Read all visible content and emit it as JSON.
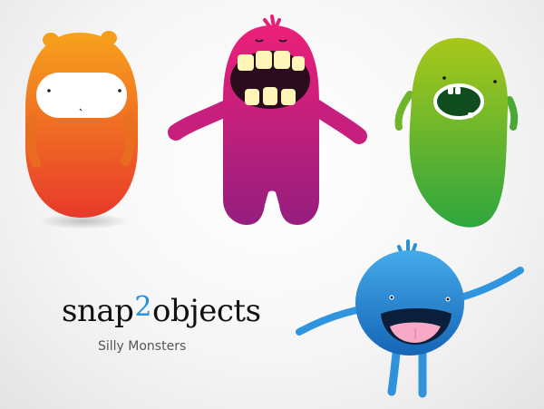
{
  "brand": {
    "name_part1": "snap",
    "name_part2": "2",
    "name_part3": "objects",
    "tagline": "Silly Monsters"
  },
  "colors": {
    "orange_top": "#f7a21b",
    "orange_bottom": "#e8392b",
    "magenta_top": "#e91e7a",
    "magenta_bottom": "#9b1f7c",
    "green_top": "#a7c61a",
    "green_bottom": "#2fa83d",
    "blue_top": "#3fa6e8",
    "blue_bottom": "#1666b8",
    "brand_accent": "#1f8fe0"
  },
  "icons": {
    "orange": "orange-monster-icon",
    "magenta": "magenta-monster-icon",
    "green": "green-monster-icon",
    "blue": "blue-monster-icon"
  }
}
